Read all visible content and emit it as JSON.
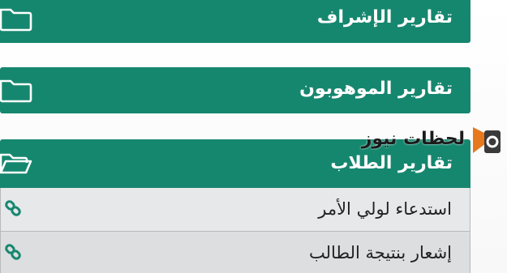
{
  "reports": {
    "supervision_label": "تقارير الإشراف",
    "gifted_label": "تقارير الموهوبون",
    "students_label": "تقارير الطلاب",
    "students_items": [
      {
        "label": "استدعاء لولي الأمر",
        "icon": "link-icon"
      },
      {
        "label": "إشعار بنتيجة الطالب",
        "icon": "link-icon"
      }
    ]
  },
  "watermark": {
    "text": "لحظات نيوز",
    "icon": "news-logo-icon"
  },
  "colors": {
    "accent": "#16876f",
    "row_bg": "#e6e8ea",
    "row_alt_bg": "#dcdee0",
    "text_dark": "#222222",
    "logo_orange": "#e8781d"
  }
}
